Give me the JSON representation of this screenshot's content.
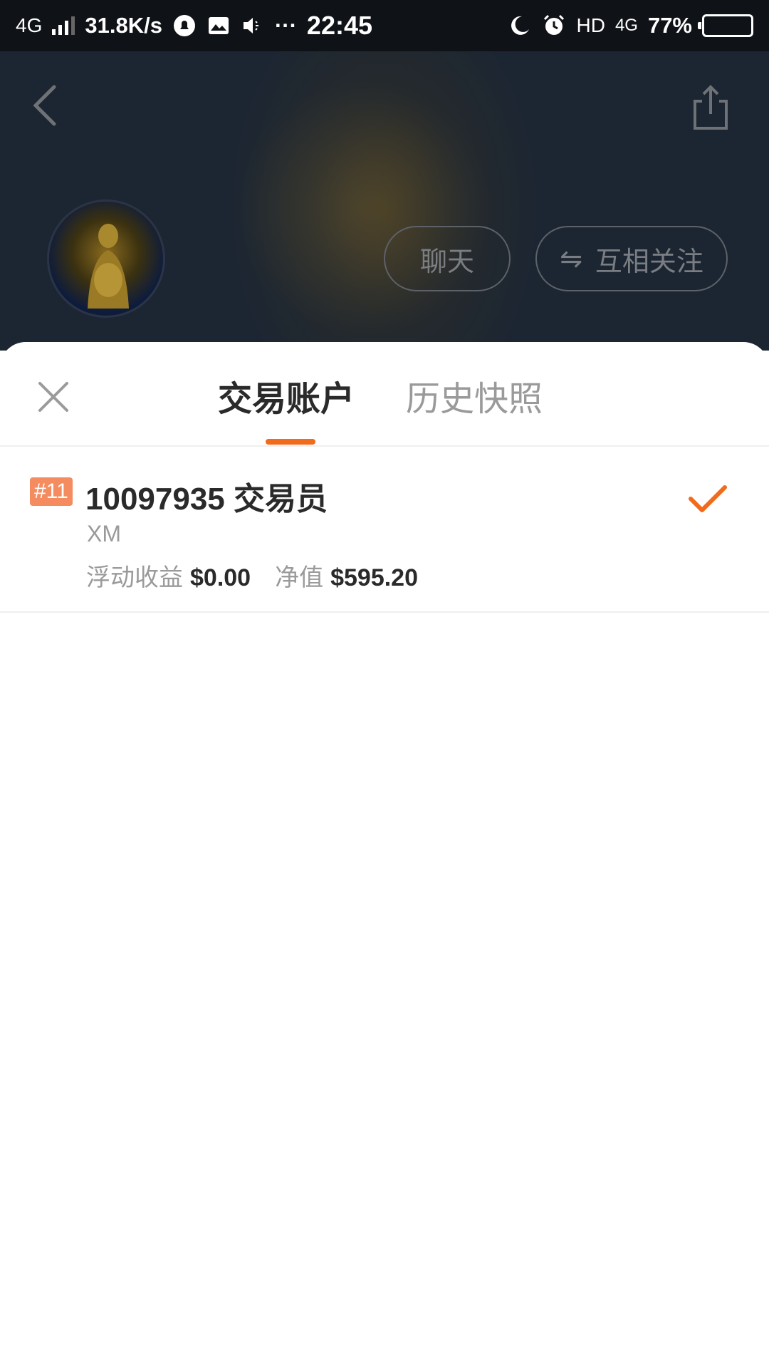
{
  "status_bar": {
    "network": "4G",
    "speed": "31.8K/s",
    "more": "···",
    "time": "22:45",
    "hd": "HD",
    "network_right": "4G",
    "battery": "77%"
  },
  "header": {
    "chat_label": "聊天",
    "follow_icon": "⇋",
    "follow_label": "互相关注"
  },
  "sheet": {
    "tabs": [
      {
        "label": "交易账户",
        "active": true
      },
      {
        "label": "历史快照",
        "active": false
      }
    ],
    "accent_color": "#f26a1b",
    "account": {
      "rank": "#11",
      "title": "10097935 交易员",
      "broker": "XM",
      "floating_label": "浮动收益",
      "floating_value": "$0.00",
      "equity_label": "净值",
      "equity_value": "$595.20",
      "selected": true
    }
  }
}
